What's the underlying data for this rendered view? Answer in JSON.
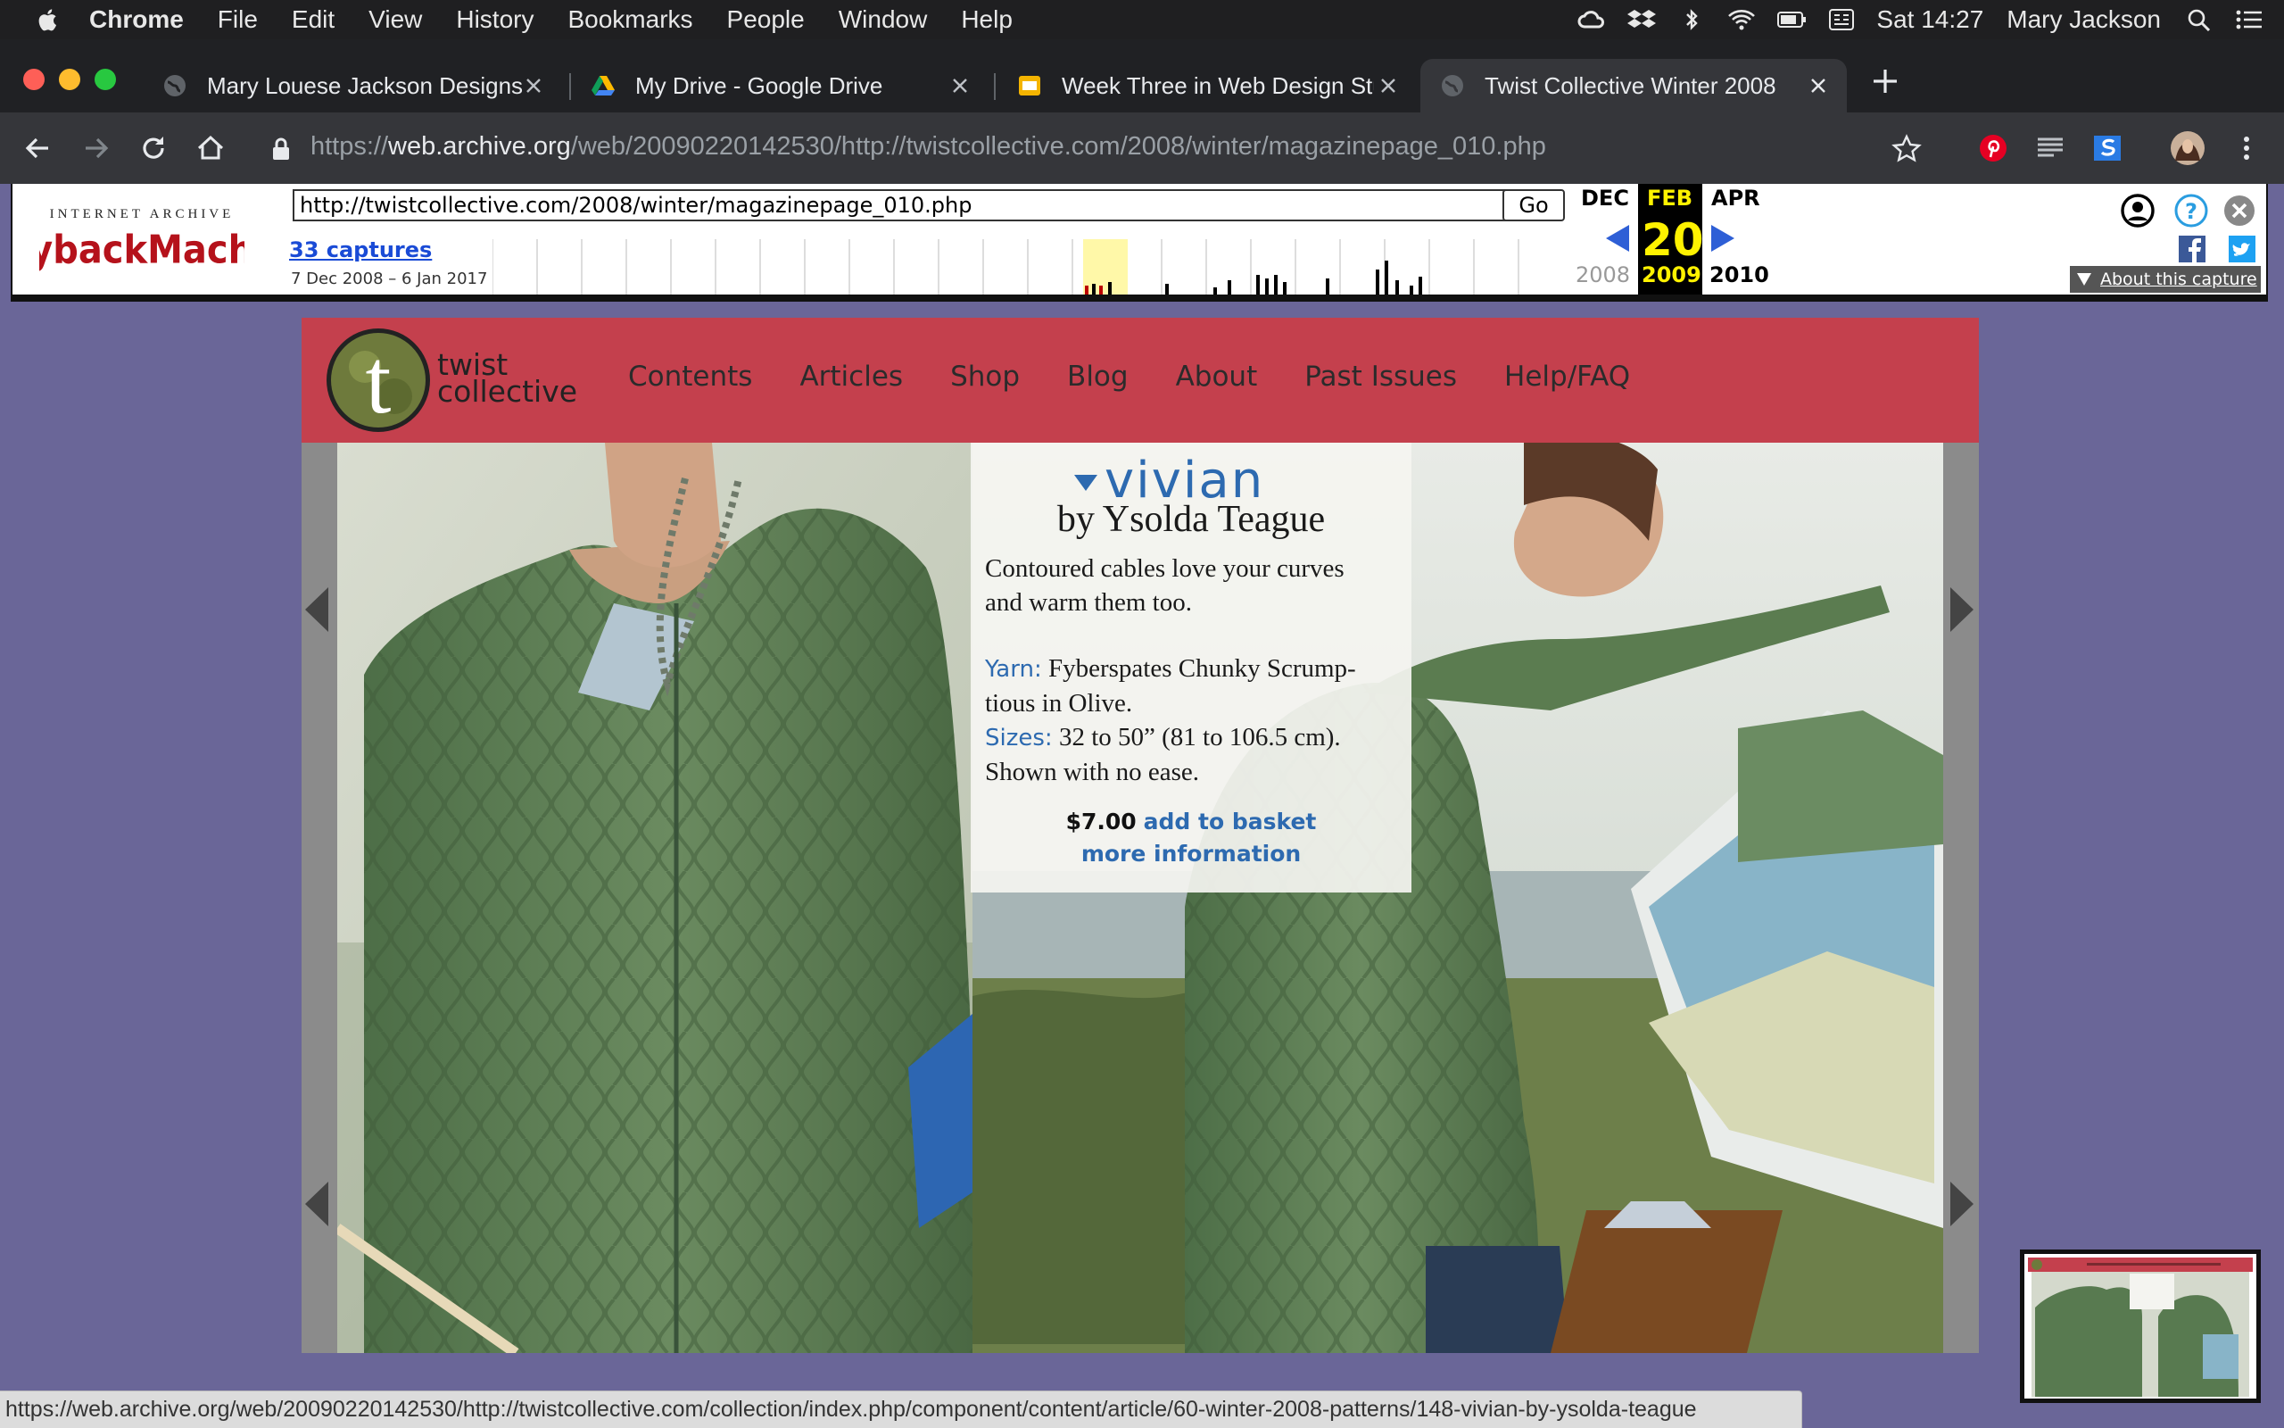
{
  "menubar": {
    "app": "Chrome",
    "items": [
      "File",
      "Edit",
      "View",
      "History",
      "Bookmarks",
      "People",
      "Window",
      "Help"
    ],
    "clock": "Sat 14:27",
    "user": "Mary Jackson"
  },
  "tabs": [
    {
      "title": "Mary Louese Jackson Designs",
      "icon": "globe-icon",
      "active": false
    },
    {
      "title": "My Drive - Google Drive",
      "icon": "google-drive-icon",
      "active": false
    },
    {
      "title": "Week Three in Web Design Stu",
      "icon": "google-slides-icon",
      "active": false
    },
    {
      "title": "Twist Collective Winter 2008",
      "icon": "globe-icon",
      "active": true
    }
  ],
  "toolbar": {
    "url_scheme": "https://",
    "url_host": "web.archive.org",
    "url_path": "/web/20090220142530/http://twistcollective.com/2008/winter/magazinepage_010.php"
  },
  "wayback": {
    "input_value": "http://twistcollective.com/2008/winter/magazinepage_010.php",
    "go_label": "Go",
    "captures_link": "33 captures",
    "date_range": "7 Dec 2008 – 6 Jan 2017",
    "prev_month": "DEC",
    "cur_month": "FEB",
    "next_month": "APR",
    "prev_year": "2008",
    "cur_year": "2009",
    "next_year": "2010",
    "cur_day": "20",
    "about_label": "About this capture",
    "accent": "#fff200"
  },
  "site": {
    "logo_letter": "t",
    "logo_line1": "twist",
    "logo_line2": "collective",
    "nav": [
      "Contents",
      "Articles",
      "Shop",
      "Blog",
      "About",
      "Past Issues",
      "Help/FAQ"
    ],
    "header_color": "#c4404d",
    "pattern": {
      "name": "vivian",
      "designer": "by Ysolda Teague",
      "description_line1": "Contoured cables love your curves",
      "description_line2": "and warm them too.",
      "yarn_label": "Yarn:",
      "yarn_value_line1": "Fyberspates Chunky Scrump-",
      "yarn_value_line2": "tious in Olive.",
      "sizes_label": "Sizes:",
      "sizes_value": "32 to 50” (81 to 106.5 cm).",
      "ease_note": "Shown with no ease.",
      "price": "$7.00",
      "basket_link": "add to basket",
      "more_link": "more information"
    }
  },
  "status_url": "https://web.archive.org/web/20090220142530/http://twistcollective.com/collection/index.php/component/content/article/60-winter-2008-patterns/148-vivian-by-ysolda-teague"
}
